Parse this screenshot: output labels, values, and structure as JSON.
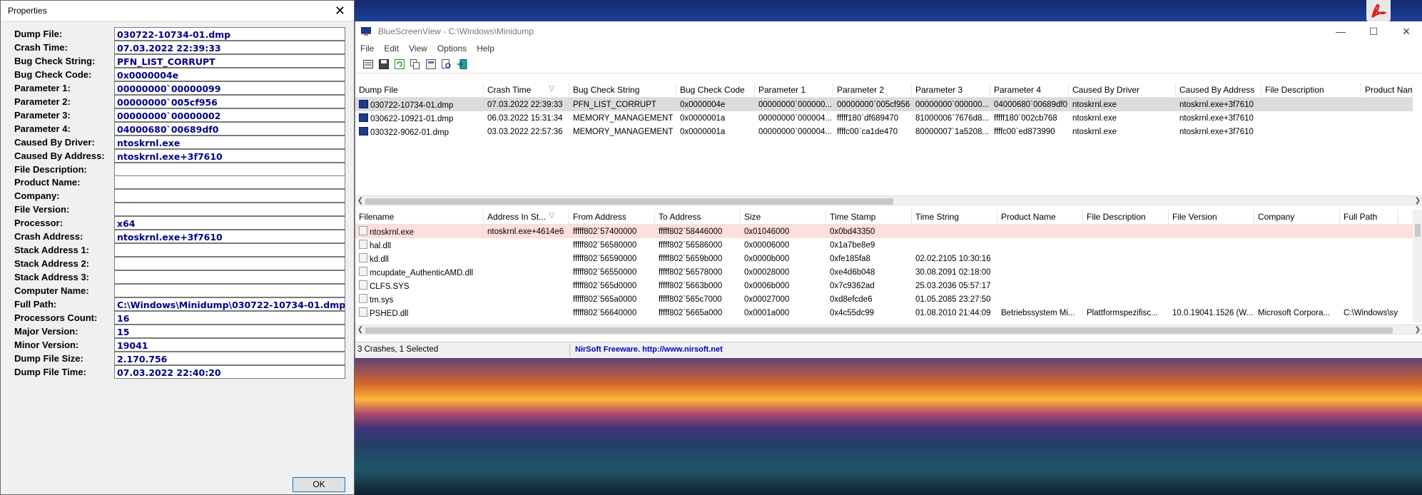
{
  "properties": {
    "title": "Properties",
    "close": "✕",
    "fields": [
      {
        "label": "Dump File:",
        "value": "030722-10734-01.dmp"
      },
      {
        "label": "Crash Time:",
        "value": "07.03.2022 22:39:33"
      },
      {
        "label": "Bug Check String:",
        "value": "PFN_LIST_CORRUPT"
      },
      {
        "label": "Bug Check Code:",
        "value": "0x0000004e"
      },
      {
        "label": "Parameter 1:",
        "value": "00000000`00000099"
      },
      {
        "label": "Parameter 2:",
        "value": "00000000`005cf956"
      },
      {
        "label": "Parameter 3:",
        "value": "00000000`00000002"
      },
      {
        "label": "Parameter 4:",
        "value": "04000680`00689df0"
      },
      {
        "label": "Caused By Driver:",
        "value": "ntoskrnl.exe"
      },
      {
        "label": "Caused By Address:",
        "value": "ntoskrnl.exe+3f7610"
      },
      {
        "label": "File Description:",
        "value": ""
      },
      {
        "label": "Product Name:",
        "value": ""
      },
      {
        "label": "Company:",
        "value": ""
      },
      {
        "label": "File Version:",
        "value": ""
      },
      {
        "label": "Processor:",
        "value": "x64"
      },
      {
        "label": "Crash Address:",
        "value": "ntoskrnl.exe+3f7610"
      },
      {
        "label": "Stack Address 1:",
        "value": ""
      },
      {
        "label": "Stack Address 2:",
        "value": ""
      },
      {
        "label": "Stack Address 3:",
        "value": ""
      },
      {
        "label": "Computer Name:",
        "value": ""
      },
      {
        "label": "Full Path:",
        "value": "C:\\Windows\\Minidump\\030722-10734-01.dmp"
      },
      {
        "label": "Processors Count:",
        "value": "16"
      },
      {
        "label": "Major Version:",
        "value": "15"
      },
      {
        "label": "Minor Version:",
        "value": "19041"
      },
      {
        "label": "Dump File Size:",
        "value": "2.170.756"
      },
      {
        "label": "Dump File Time:",
        "value": "07.03.2022 22:40:20"
      }
    ],
    "ok_label": "OK"
  },
  "main": {
    "title": "BlueScreenView - C:\\Windows\\Minidump",
    "win_buttons": [
      "—",
      "☐",
      "✕"
    ],
    "menu": [
      "File",
      "Edit",
      "View",
      "Options",
      "Help"
    ],
    "top_headers": [
      "Dump File",
      "Crash Time",
      "Bug Check String",
      "Bug Check Code",
      "Parameter 1",
      "Parameter 2",
      "Parameter 3",
      "Parameter 4",
      "Caused By Driver",
      "Caused By Address",
      "File Description",
      "Product Name"
    ],
    "sort_arrow": "▽",
    "top_rows": [
      [
        "030722-10734-01.dmp",
        "07.03.2022 22:39:33",
        "PFN_LIST_CORRUPT",
        "0x0000004e",
        "00000000`000000...",
        "00000000`005cf956",
        "00000000`000000...",
        "04000680`00689df0",
        "ntoskrnl.exe",
        "ntoskrnl.exe+3f7610",
        "",
        ""
      ],
      [
        "030622-10921-01.dmp",
        "06.03.2022 15:31:34",
        "MEMORY_MANAGEMENT",
        "0x0000001a",
        "00000000`000004...",
        "fffff180`df689470",
        "81000006`7676d8...",
        "fffff180`002cb768",
        "ntoskrnl.exe",
        "ntoskrnl.exe+3f7610",
        "",
        ""
      ],
      [
        "030322-9062-01.dmp",
        "03.03.2022 22:57:36",
        "MEMORY_MANAGEMENT",
        "0x0000001a",
        "00000000`000004...",
        "ffffc00`ca1de470",
        "80000007`1a5208...",
        "ffffc00`ed873990",
        "ntoskrnl.exe",
        "ntoskrnl.exe+3f7610",
        "",
        ""
      ]
    ],
    "bottom_headers": [
      "Filename",
      "Address In St...",
      "From Address",
      "To Address",
      "Size",
      "Time Stamp",
      "Time String",
      "Product Name",
      "File Description",
      "File Version",
      "Company",
      "Full Path"
    ],
    "bottom_rows": [
      [
        "ntoskrnl.exe",
        "ntoskrnl.exe+4614e6",
        "fffff802`57400000",
        "fffff802`58446000",
        "0x01046000",
        "0x0bd43350",
        "",
        "",
        "",
        "",
        "",
        ""
      ],
      [
        "hal.dll",
        "",
        "fffff802`56580000",
        "fffff802`56586000",
        "0x00006000",
        "0x1a7be8e9",
        "",
        "",
        "",
        "",
        "",
        ""
      ],
      [
        "kd.dll",
        "",
        "fffff802`56590000",
        "fffff802`5659b000",
        "0x0000b000",
        "0xfe185fa8",
        "02.02.2105 10:30:16",
        "",
        "",
        "",
        "",
        ""
      ],
      [
        "mcupdate_AuthenticAMD.dll",
        "",
        "fffff802`56550000",
        "fffff802`56578000",
        "0x00028000",
        "0xe4d6b048",
        "30.08.2091 02:18:00",
        "",
        "",
        "",
        "",
        ""
      ],
      [
        "CLFS.SYS",
        "",
        "fffff802`565d0000",
        "fffff802`5663b000",
        "0x0006b000",
        "0x7c9362ad",
        "25.03.2036 05:57:17",
        "",
        "",
        "",
        "",
        ""
      ],
      [
        "tm.sys",
        "",
        "fffff802`565a0000",
        "fffff802`565c7000",
        "0x00027000",
        "0xd8efcde6",
        "01.05.2085 23:27:50",
        "",
        "",
        "",
        "",
        ""
      ],
      [
        "PSHED.dll",
        "",
        "fffff802`56640000",
        "fffff802`5665a000",
        "0x0001a000",
        "0x4c55dc99",
        "01.08.2010 21:44:09",
        "Betriebssystem Mi...",
        "Plattformspezifisc...",
        "10.0.19041.1526 (W...",
        "Microsoft Corpora...",
        "C:\\Windows\\syste"
      ]
    ],
    "status_count": "3 Crashes, 1 Selected",
    "status_link": "NirSoft Freeware.  http://www.nirsoft.net"
  }
}
